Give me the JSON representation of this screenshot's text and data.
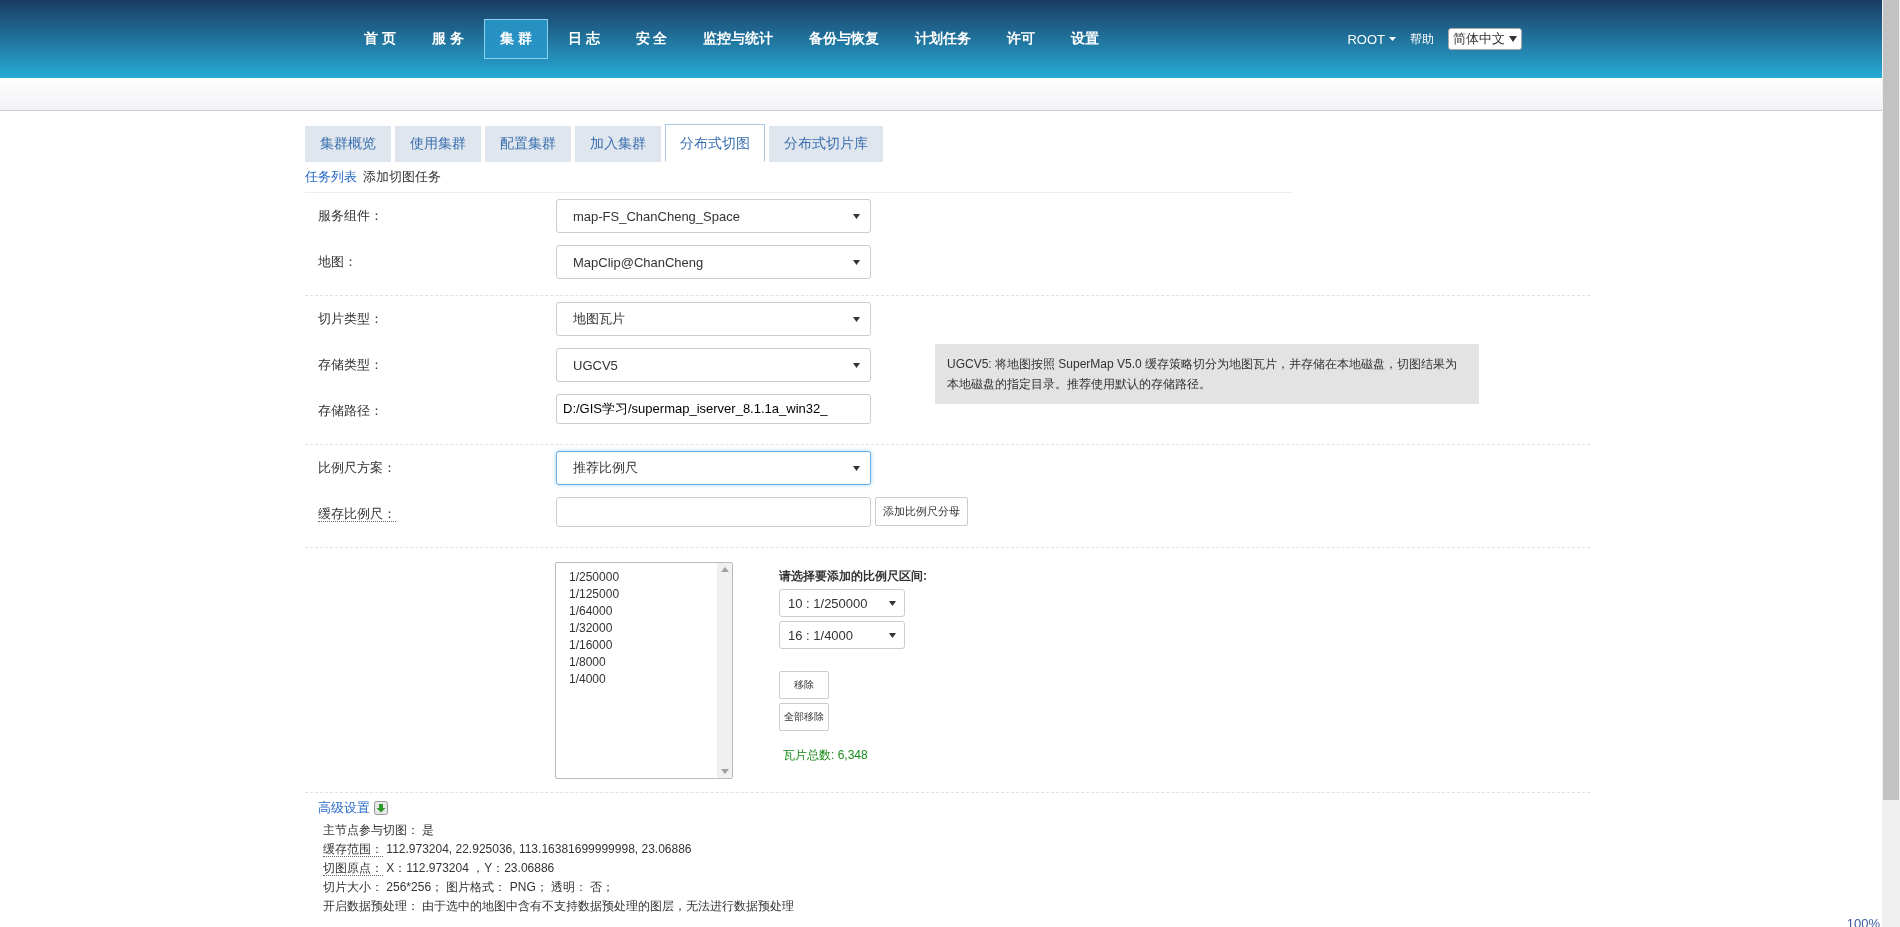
{
  "nav": {
    "items": [
      {
        "label": "首 页",
        "selected": false
      },
      {
        "label": "服 务",
        "selected": false
      },
      {
        "label": "集 群",
        "selected": true
      },
      {
        "label": "日 志",
        "selected": false
      },
      {
        "label": "安 全",
        "selected": false
      },
      {
        "label": "监控与统计",
        "selected": false
      },
      {
        "label": "备份与恢复",
        "selected": false
      },
      {
        "label": "计划任务",
        "selected": false
      },
      {
        "label": "许可",
        "selected": false
      },
      {
        "label": "设置",
        "selected": false
      }
    ],
    "user": "ROOT",
    "help": "帮助",
    "language": "简体中文"
  },
  "tabs": [
    {
      "label": "集群概览",
      "selected": false
    },
    {
      "label": "使用集群",
      "selected": false
    },
    {
      "label": "配置集群",
      "selected": false
    },
    {
      "label": "加入集群",
      "selected": false
    },
    {
      "label": "分布式切图",
      "selected": true
    },
    {
      "label": "分布式切片库",
      "selected": false
    }
  ],
  "breadcrumb": {
    "link": "任务列表",
    "current": "添加切图任务"
  },
  "sections": [
    {
      "fields": [
        {
          "kind": "select",
          "label": "服务组件：",
          "value": "map-FS_ChanCheng_Space",
          "focused": false
        },
        {
          "kind": "select",
          "label": "地图：",
          "value": "MapClip@ChanCheng",
          "focused": false
        }
      ]
    },
    {
      "fields": [
        {
          "kind": "select",
          "label": "切片类型：",
          "value": "地图瓦片",
          "focused": false
        },
        {
          "kind": "select",
          "label": "存储类型：",
          "value": "UGCV5",
          "focused": false,
          "note": "UGCV5: 将地图按照 SuperMap V5.0 缓存策略切分为地图瓦片，并存储在本地磁盘，切图结果为本地磁盘的指定目录。推荐使用默认的存储路径。"
        },
        {
          "kind": "text",
          "label": "存储路径：",
          "value": "D:/GIS学习/supermap_iserver_8.1.1a_win32_"
        }
      ]
    },
    {
      "fields": [
        {
          "kind": "select",
          "label": "比例尺方案：",
          "value": "推荐比例尺",
          "focused": true
        },
        {
          "kind": "text-button",
          "label": "缓存比例尺：",
          "button": "添加比例尺分母",
          "abbr": true
        }
      ]
    }
  ],
  "scales": {
    "options": [
      "1/250000",
      "1/125000",
      "1/64000",
      "1/32000",
      "1/16000",
      "1/8000",
      "1/4000"
    ],
    "title": "请选择要添加的比例尺区间:",
    "from": "10 : 1/250000",
    "to": "16 : 1/4000",
    "buttons": [
      "移除",
      "全部移除"
    ],
    "total": "瓦片总数: 6,348"
  },
  "advanced": {
    "title": "高级设置",
    "lines": [
      {
        "label": "主节点参与切图：",
        "value": "是",
        "abbr": false
      },
      {
        "label": "缓存范围：",
        "value": "112.973204, 22.925036, 113.16381699999998, 23.06886",
        "abbr": true
      },
      {
        "label": "切图原点：",
        "value": "X：112.973204 ，Y：23.06886",
        "abbr": true
      },
      {
        "label": "切片大小：",
        "value": "256*256； 图片格式： PNG； 透明： 否；",
        "abbr": false
      },
      {
        "label": "开启数据预处理：",
        "value": "由于选中的地图中含有不支持数据预处理的图层，无法进行数据预处理",
        "abbr": false
      }
    ]
  },
  "status": {
    "zoom": "100%"
  }
}
